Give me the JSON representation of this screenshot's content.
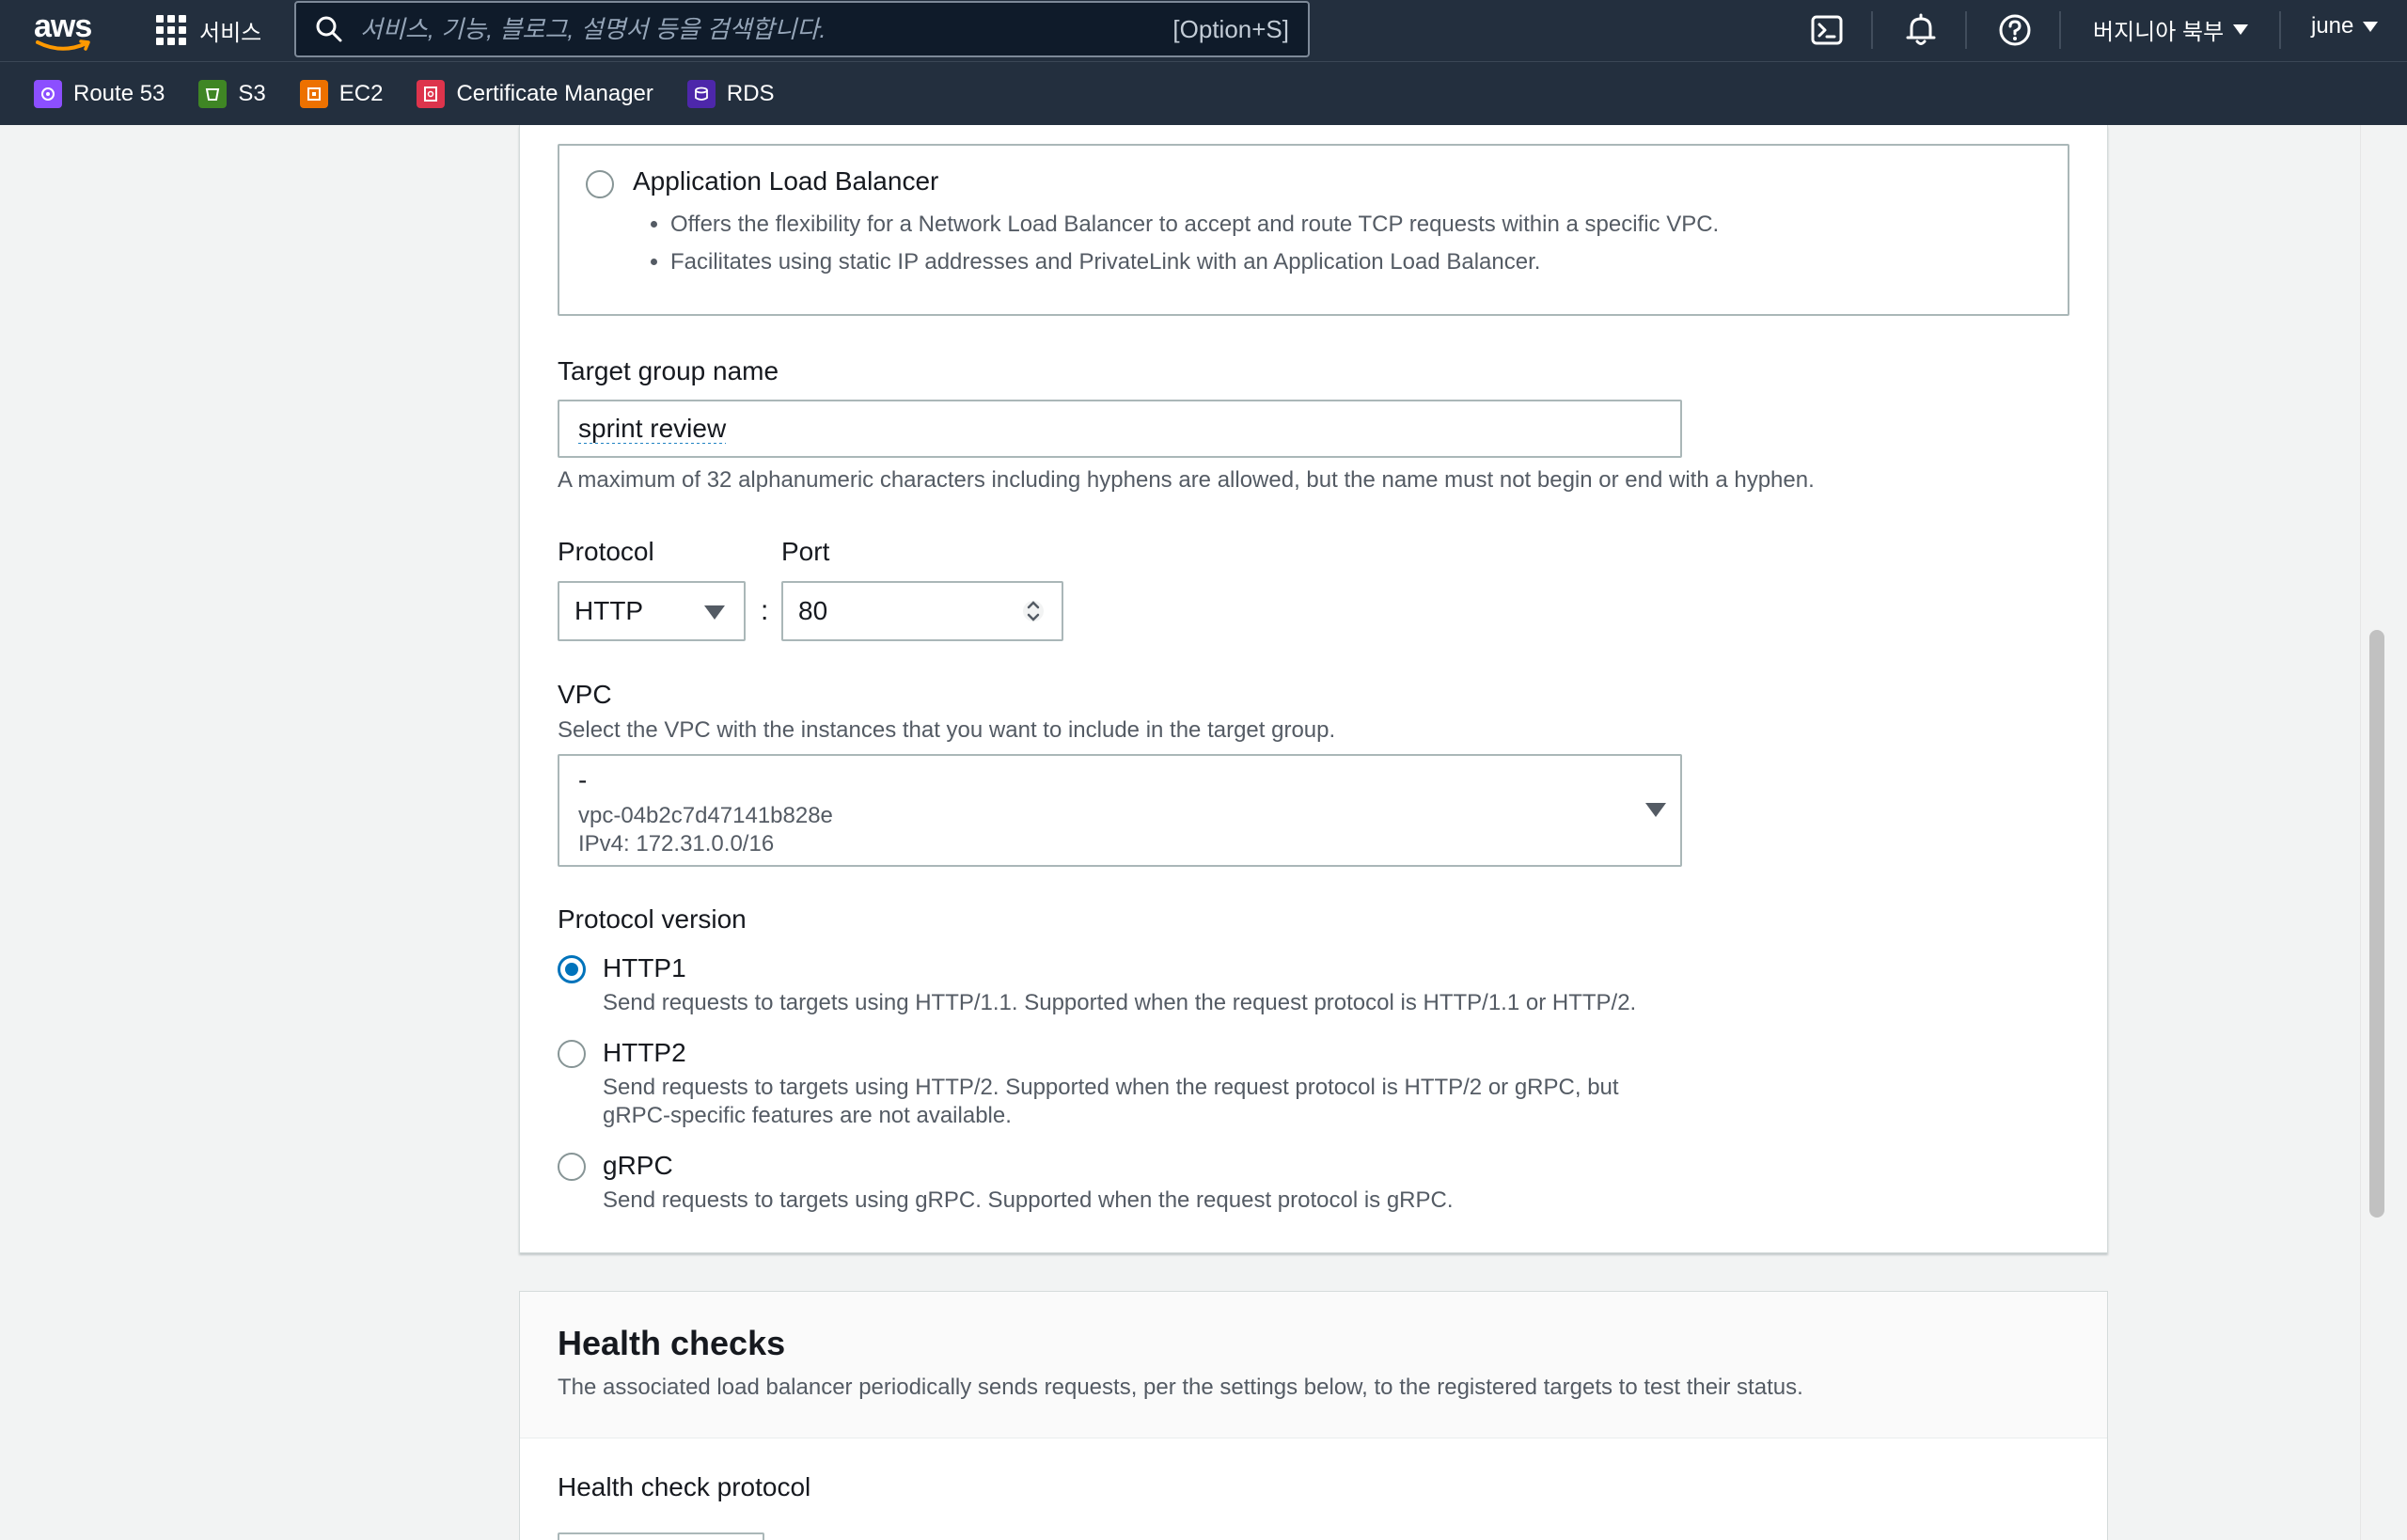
{
  "header": {
    "logo_text": "aws",
    "services_label": "서비스",
    "search_placeholder": "서비스, 기능, 블로그, 설명서 등을 검색합니다.",
    "search_shortcut": "[Option+S]",
    "icons": [
      "cloudshell-icon",
      "bell-icon",
      "help-icon"
    ],
    "region_label": "버지니아 북부",
    "user_label": "june"
  },
  "favorites": [
    {
      "label": "Route 53",
      "icon": "route53-icon",
      "color": "#8c4fff"
    },
    {
      "label": "S3",
      "icon": "s3-icon",
      "color": "#3f8624"
    },
    {
      "label": "EC2",
      "icon": "ec2-icon",
      "color": "#ed7100"
    },
    {
      "label": "Certificate Manager",
      "icon": "certificate-manager-icon",
      "color": "#dd344c"
    },
    {
      "label": "RDS",
      "icon": "rds-icon",
      "color": "#4d27aa"
    }
  ],
  "target_type": {
    "alb": {
      "label": "Application Load Balancer",
      "selected": false,
      "bullets": [
        "Offers the flexibility for a Network Load Balancer to accept and route TCP requests within a specific VPC.",
        "Facilitates using static IP addresses and PrivateLink with an Application Load Balancer."
      ]
    }
  },
  "target_group": {
    "label": "Target group name",
    "value": "sprint review",
    "hint": "A maximum of 32 alphanumeric characters including hyphens are allowed, but the name must not begin or end with a hyphen."
  },
  "protocol": {
    "label": "Protocol",
    "value": "HTTP",
    "separator": ":"
  },
  "port": {
    "label": "Port",
    "value": "80"
  },
  "vpc": {
    "label": "VPC",
    "description": "Select the VPC with the instances that you want to include in the target group.",
    "selected_name": "-",
    "selected_id": "vpc-04b2c7d47141b828e",
    "selected_cidr": "IPv4: 172.31.0.0/16"
  },
  "protocol_version": {
    "label": "Protocol version",
    "options": [
      {
        "label": "HTTP1",
        "desc": "Send requests to targets using HTTP/1.1. Supported when the request protocol is HTTP/1.1 or HTTP/2.",
        "selected": true
      },
      {
        "label": "HTTP2",
        "desc": "Send requests to targets using HTTP/2. Supported when the request protocol is HTTP/2 or gRPC, but gRPC-specific features are not available.",
        "selected": false
      },
      {
        "label": "gRPC",
        "desc": "Send requests to targets using gRPC. Supported when the request protocol is gRPC.",
        "selected": false
      }
    ]
  },
  "health_checks": {
    "title": "Health checks",
    "description": "The associated load balancer periodically sends requests, per the settings below, to the registered targets to test their status.",
    "protocol_label": "Health check protocol"
  },
  "colors": {
    "nav_bg": "#232f3e",
    "accent": "#0073bb",
    "text_secondary": "#545b64"
  }
}
